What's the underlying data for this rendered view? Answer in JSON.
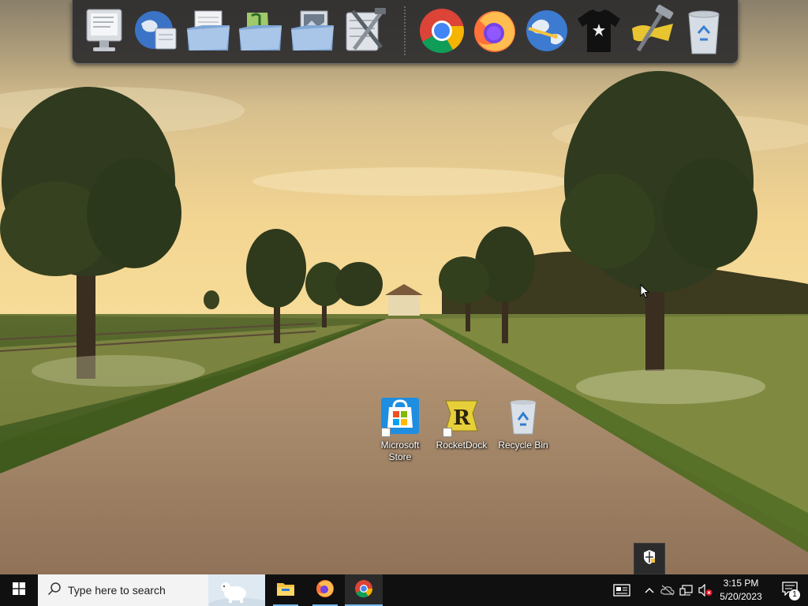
{
  "dock": {
    "items": [
      {
        "icon": "computer-icon"
      },
      {
        "icon": "network-globe-icon"
      },
      {
        "icon": "documents-folder-icon"
      },
      {
        "icon": "music-folder-icon"
      },
      {
        "icon": "pictures-folder-icon"
      },
      {
        "icon": "tools-icon"
      },
      {
        "icon": "chrome-icon"
      },
      {
        "icon": "firefox-icon"
      },
      {
        "icon": "internet-explorer-icon"
      },
      {
        "icon": "tshirt-icon"
      },
      {
        "icon": "hammer-icon"
      },
      {
        "icon": "recycle-bin-icon"
      }
    ]
  },
  "desktop": {
    "icons": [
      {
        "label": "Microsoft Store",
        "icon": "microsoft-store-icon"
      },
      {
        "label": "RocketDock",
        "icon": "rocketdock-icon"
      },
      {
        "label": "Recycle Bin",
        "icon": "recycle-bin-icon"
      }
    ]
  },
  "taskbar": {
    "search_placeholder": "Type here to search",
    "apps": [
      {
        "icon": "file-explorer-icon",
        "active": false
      },
      {
        "icon": "firefox-icon",
        "active": false
      },
      {
        "icon": "chrome-icon",
        "active": true
      }
    ],
    "clock": {
      "time": "3:15 PM",
      "date": "5/20/2023"
    },
    "notification_count": "1"
  },
  "colors": {
    "taskbar": "#101010",
    "accent_underline": "#76b9ed",
    "search_bg": "#f3f3f3",
    "dock_bg": "#28282a"
  }
}
